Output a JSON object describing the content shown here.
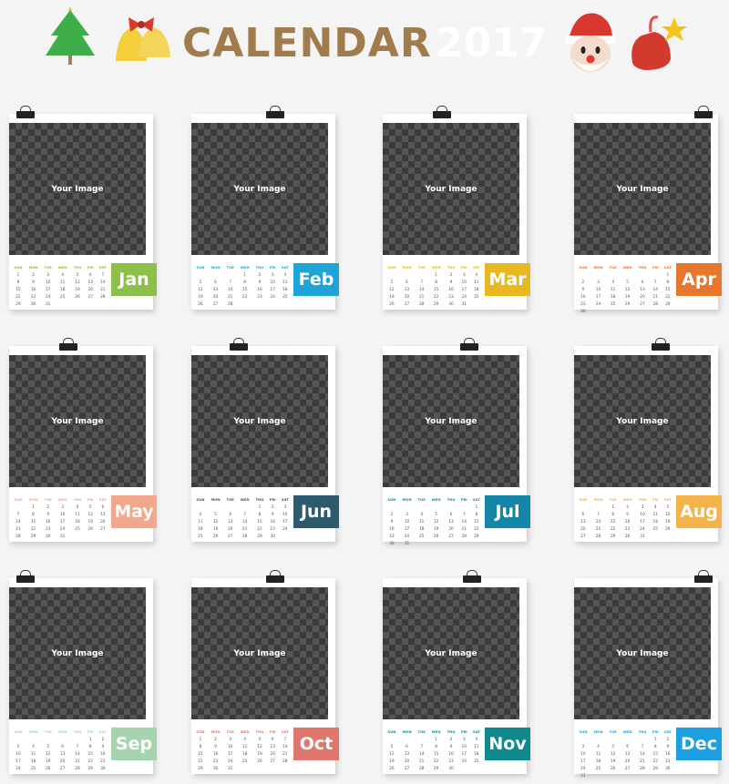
{
  "header": {
    "title": "CALENDAR",
    "year": "2017",
    "decorations": [
      "christmas-tree-icon",
      "bells-icon",
      "santa-icon",
      "gift-sack-icon"
    ]
  },
  "placeholder": "Your Image",
  "weekdays": [
    "SUN",
    "MON",
    "TUE",
    "WED",
    "THU",
    "FRI",
    "SAT"
  ],
  "months": [
    {
      "label": "Jan",
      "color": "#8dc04a",
      "weeks": [
        [
          "1",
          "2",
          "3",
          "4",
          "5",
          "6",
          "7"
        ],
        [
          "8",
          "9",
          "10",
          "11",
          "12",
          "13",
          "14"
        ],
        [
          "15",
          "16",
          "17",
          "18",
          "19",
          "20",
          "21"
        ],
        [
          "22",
          "23",
          "24",
          "25",
          "26",
          "27",
          "28"
        ],
        [
          "29",
          "30",
          "31",
          "",
          "",
          "",
          ""
        ]
      ]
    },
    {
      "label": "Feb",
      "color": "#1fa4d8",
      "weeks": [
        [
          "",
          "",
          "",
          "1",
          "2",
          "3",
          "4"
        ],
        [
          "5",
          "6",
          "7",
          "8",
          "9",
          "10",
          "11"
        ],
        [
          "12",
          "13",
          "14",
          "15",
          "16",
          "17",
          "18"
        ],
        [
          "19",
          "20",
          "21",
          "22",
          "23",
          "24",
          "25"
        ],
        [
          "26",
          "27",
          "28",
          "",
          "",
          "",
          ""
        ]
      ]
    },
    {
      "label": "Mar",
      "color": "#e8b820",
      "weeks": [
        [
          "",
          "",
          "",
          "1",
          "2",
          "3",
          "4"
        ],
        [
          "5",
          "6",
          "7",
          "8",
          "9",
          "10",
          "11"
        ],
        [
          "12",
          "13",
          "14",
          "15",
          "16",
          "17",
          "18"
        ],
        [
          "19",
          "20",
          "21",
          "22",
          "23",
          "24",
          "25"
        ],
        [
          "26",
          "27",
          "28",
          "29",
          "30",
          "31",
          ""
        ]
      ]
    },
    {
      "label": "Apr",
      "color": "#e8772e",
      "weeks": [
        [
          "",
          "",
          "",
          "",
          "",
          "",
          "1"
        ],
        [
          "2",
          "3",
          "4",
          "5",
          "6",
          "7",
          "8"
        ],
        [
          "9",
          "10",
          "11",
          "12",
          "13",
          "14",
          "15"
        ],
        [
          "16",
          "17",
          "18",
          "19",
          "20",
          "21",
          "22"
        ],
        [
          "23",
          "24",
          "25",
          "26",
          "27",
          "28",
          "29"
        ],
        [
          "30",
          "",
          "",
          "",
          "",
          "",
          ""
        ]
      ]
    },
    {
      "label": "May",
      "color": "#f2a68c",
      "weeks": [
        [
          "",
          "1",
          "2",
          "3",
          "4",
          "5",
          "6"
        ],
        [
          "7",
          "8",
          "9",
          "10",
          "11",
          "12",
          "13"
        ],
        [
          "14",
          "15",
          "16",
          "17",
          "18",
          "19",
          "20"
        ],
        [
          "21",
          "22",
          "23",
          "24",
          "25",
          "26",
          "27"
        ],
        [
          "28",
          "29",
          "30",
          "31",
          "",
          "",
          ""
        ]
      ]
    },
    {
      "label": "Jun",
      "color": "#2e5a6e",
      "weeks": [
        [
          "",
          "",
          "",
          "",
          "1",
          "2",
          "3"
        ],
        [
          "4",
          "5",
          "6",
          "7",
          "8",
          "9",
          "10"
        ],
        [
          "11",
          "12",
          "13",
          "14",
          "15",
          "16",
          "17"
        ],
        [
          "18",
          "19",
          "20",
          "21",
          "22",
          "23",
          "24"
        ],
        [
          "25",
          "26",
          "27",
          "28",
          "29",
          "30",
          ""
        ]
      ]
    },
    {
      "label": "Jul",
      "color": "#1686a8",
      "weeks": [
        [
          "",
          "",
          "",
          "",
          "",
          "",
          "1"
        ],
        [
          "2",
          "3",
          "4",
          "5",
          "6",
          "7",
          "8"
        ],
        [
          "9",
          "10",
          "11",
          "12",
          "13",
          "14",
          "15"
        ],
        [
          "16",
          "17",
          "18",
          "19",
          "20",
          "21",
          "22"
        ],
        [
          "23",
          "24",
          "25",
          "26",
          "27",
          "28",
          "29"
        ],
        [
          "30",
          "31",
          "",
          "",
          "",
          "",
          ""
        ]
      ]
    },
    {
      "label": "Aug",
      "color": "#f2b24c",
      "weeks": [
        [
          "",
          "",
          "1",
          "2",
          "3",
          "4",
          "5"
        ],
        [
          "6",
          "7",
          "8",
          "9",
          "10",
          "11",
          "12"
        ],
        [
          "13",
          "14",
          "15",
          "16",
          "17",
          "18",
          "19"
        ],
        [
          "20",
          "21",
          "22",
          "23",
          "24",
          "25",
          "26"
        ],
        [
          "27",
          "28",
          "29",
          "30",
          "31",
          "",
          ""
        ]
      ]
    },
    {
      "label": "Sep",
      "color": "#a6d4b0",
      "weeks": [
        [
          "",
          "",
          "",
          "",
          "",
          "1",
          "2"
        ],
        [
          "3",
          "4",
          "5",
          "6",
          "7",
          "8",
          "9"
        ],
        [
          "10",
          "11",
          "12",
          "13",
          "14",
          "15",
          "16"
        ],
        [
          "17",
          "18",
          "19",
          "20",
          "21",
          "22",
          "23"
        ],
        [
          "24",
          "25",
          "26",
          "27",
          "28",
          "29",
          "30"
        ]
      ]
    },
    {
      "label": "Oct",
      "color": "#e0776e",
      "weeks": [
        [
          "1",
          "2",
          "3",
          "4",
          "5",
          "6",
          "7"
        ],
        [
          "8",
          "9",
          "10",
          "11",
          "12",
          "13",
          "14"
        ],
        [
          "15",
          "16",
          "17",
          "18",
          "19",
          "20",
          "21"
        ],
        [
          "22",
          "23",
          "24",
          "25",
          "26",
          "27",
          "28"
        ],
        [
          "29",
          "30",
          "31",
          "",
          "",
          "",
          ""
        ]
      ]
    },
    {
      "label": "Nov",
      "color": "#0e8a8c",
      "weeks": [
        [
          "",
          "",
          "",
          "1",
          "2",
          "3",
          "4"
        ],
        [
          "5",
          "6",
          "7",
          "8",
          "9",
          "10",
          "11"
        ],
        [
          "12",
          "13",
          "14",
          "15",
          "16",
          "17",
          "18"
        ],
        [
          "19",
          "20",
          "21",
          "22",
          "23",
          "24",
          "25"
        ],
        [
          "26",
          "27",
          "28",
          "29",
          "30",
          "",
          ""
        ]
      ]
    },
    {
      "label": "Dec",
      "color": "#1c9fe0",
      "weeks": [
        [
          "",
          "",
          "",
          "",
          "",
          "1",
          "2"
        ],
        [
          "3",
          "4",
          "5",
          "6",
          "7",
          "8",
          "9"
        ],
        [
          "10",
          "11",
          "12",
          "13",
          "14",
          "15",
          "16"
        ],
        [
          "17",
          "18",
          "19",
          "20",
          "21",
          "22",
          "23"
        ],
        [
          "24",
          "25",
          "26",
          "27",
          "28",
          "29",
          "30"
        ],
        [
          "31",
          "",
          "",
          "",
          "",
          "",
          ""
        ]
      ]
    }
  ]
}
